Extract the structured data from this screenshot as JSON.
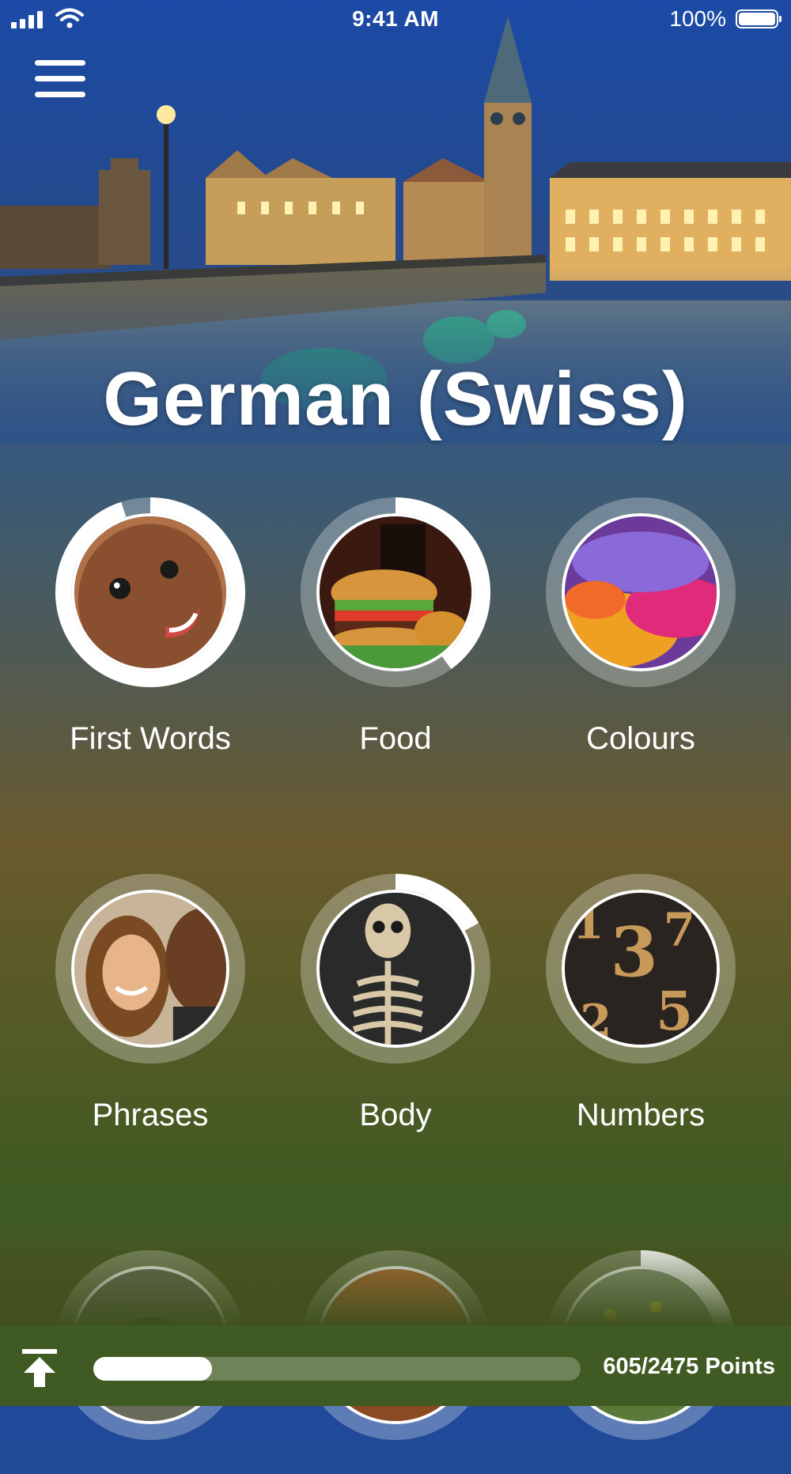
{
  "status_bar": {
    "time": "9:41 AM",
    "battery": "100%"
  },
  "header": {
    "title": "German (Swiss)",
    "menu_icon": "hamburger-menu-icon"
  },
  "topics": [
    {
      "label": "First Words",
      "progress": 0.95,
      "image": "baby-face"
    },
    {
      "label": "Food",
      "progress": 0.4,
      "image": "burger-cola"
    },
    {
      "label": "Colours",
      "progress": 0.0,
      "image": "colour-powder"
    },
    {
      "label": "Phrases",
      "progress": 0.0,
      "image": "smiling-couple"
    },
    {
      "label": "Body",
      "progress": 0.17,
      "image": "skeleton"
    },
    {
      "label": "Numbers",
      "progress": 0.0,
      "image": "wooden-numbers"
    },
    {
      "label": "",
      "progress": 0.0,
      "image": "headphones"
    },
    {
      "label": "",
      "progress": 0.0,
      "image": "plant-room"
    },
    {
      "label": "",
      "progress": 0.22,
      "image": "flowers"
    }
  ],
  "footer": {
    "points": "605/2475 Points",
    "progress": 0.244,
    "upload_icon": "upload-arrow-icon"
  },
  "colors": {
    "ring_track": "rgba(255,255,255,0.28)",
    "ring_fill": "#ffffff"
  }
}
